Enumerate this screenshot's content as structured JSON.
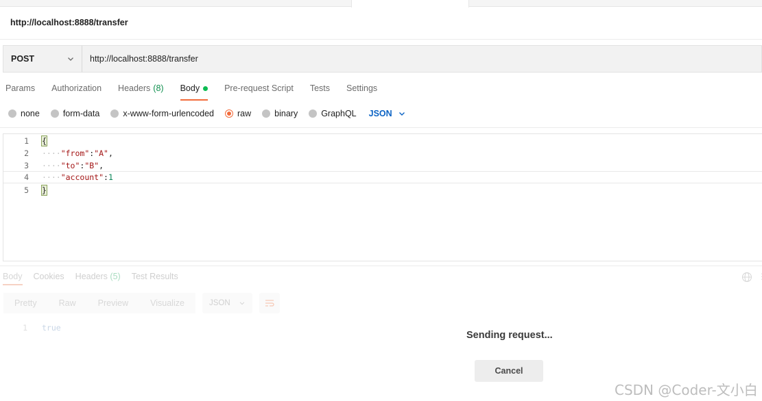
{
  "request": {
    "title": "http://localhost:8888/transfer",
    "method": "POST",
    "url": "http://localhost:8888/transfer"
  },
  "tabs": [
    {
      "label": "Params"
    },
    {
      "label": "Authorization"
    },
    {
      "label": "Headers",
      "count": "(8)"
    },
    {
      "label": "Body",
      "active": true
    },
    {
      "label": "Pre-request Script"
    },
    {
      "label": "Tests"
    },
    {
      "label": "Settings"
    }
  ],
  "body_modes": {
    "none": "none",
    "form_data": "form-data",
    "urlencoded": "x-www-form-urlencoded",
    "raw": "raw",
    "binary": "binary",
    "graphql": "GraphQL",
    "format": "JSON",
    "selected": "raw"
  },
  "editor": {
    "line_numbers": [
      "1",
      "2",
      "3",
      "4",
      "5"
    ],
    "open_brace": "{",
    "close_brace": "}",
    "indent": "····",
    "from_key": "\"from\"",
    "from_value": "\"A\"",
    "to_key": "\"to\"",
    "to_value": "\"B\"",
    "account_key": "\"account\"",
    "account_value": "1",
    "colon": ":",
    "comma": ","
  },
  "response": {
    "tabs": {
      "body": "Body",
      "cookies": "Cookies",
      "headers": "Headers",
      "headers_count": "(5)",
      "test_results": "Test Results"
    },
    "view_modes": [
      "Pretty",
      "Raw",
      "Preview",
      "Visualize"
    ],
    "format": "JSON",
    "line_number": "1",
    "value": "true"
  },
  "overlay": {
    "sending_text": "Sending request...",
    "cancel_label": "Cancel"
  },
  "watermark": "CSDN @Coder-文小白",
  "colors": {
    "accent": "#f26b3a",
    "link_blue": "#0b63c4",
    "body_dot_green": "#0cbb52"
  }
}
